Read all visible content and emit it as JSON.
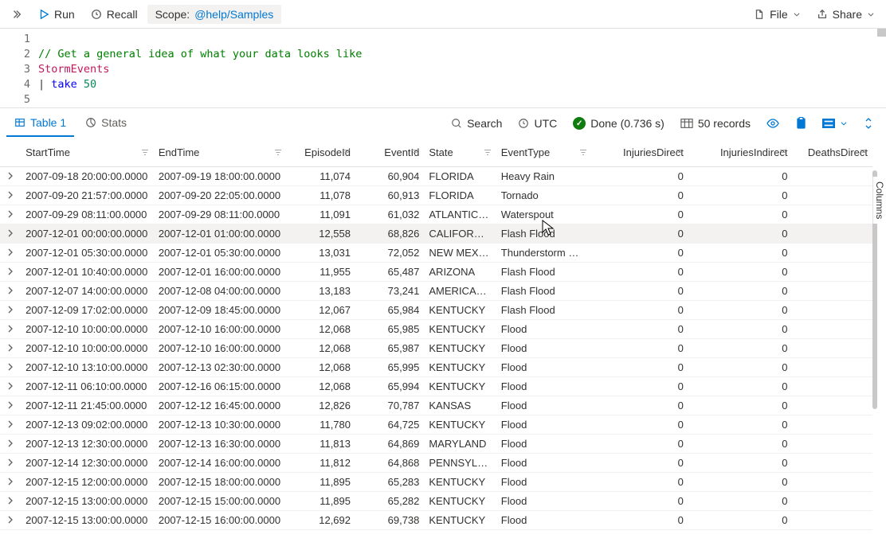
{
  "toolbar": {
    "run": "Run",
    "recall": "Recall",
    "scope_label": "Scope:",
    "scope_value": "@help/Samples",
    "file": "File",
    "share": "Share"
  },
  "editor": {
    "lines": [
      "1",
      "2",
      "3",
      "4",
      "5"
    ],
    "l1_comment": "// Get a general idea of what your data looks like",
    "l2_ident": "StormEvents",
    "l3_pipe": "| ",
    "l3_kw": "take ",
    "l3_num": "50"
  },
  "results": {
    "tab_table": "Table 1",
    "tab_stats": "Stats",
    "search": "Search",
    "utc": "UTC",
    "done": "Done (0.736 s)",
    "records": "50 records",
    "columns_tab": "Columns"
  },
  "columns": [
    "StartTime",
    "EndTime",
    "EpisodeId",
    "EventId",
    "State",
    "EventType",
    "InjuriesDirect",
    "InjuriesIndirect",
    "DeathsDirect"
  ],
  "col_align": [
    "left",
    "left",
    "right",
    "right",
    "left",
    "left",
    "right",
    "right",
    "right"
  ],
  "rows": [
    [
      "2007-09-18 20:00:00.0000",
      "2007-09-19 18:00:00.0000",
      "11,074",
      "60,904",
      "FLORIDA",
      "Heavy Rain",
      "0",
      "0",
      ""
    ],
    [
      "2007-09-20 21:57:00.0000",
      "2007-09-20 22:05:00.0000",
      "11,078",
      "60,913",
      "FLORIDA",
      "Tornado",
      "0",
      "0",
      ""
    ],
    [
      "2007-09-29 08:11:00.0000",
      "2007-09-29 08:11:00.0000",
      "11,091",
      "61,032",
      "ATLANTIC…",
      "Waterspout",
      "0",
      "0",
      ""
    ],
    [
      "2007-12-01 00:00:00.0000",
      "2007-12-01 01:00:00.0000",
      "12,558",
      "68,826",
      "CALIFORN…",
      "Flash Flood",
      "0",
      "0",
      ""
    ],
    [
      "2007-12-01 05:30:00.0000",
      "2007-12-01 05:30:00.0000",
      "13,031",
      "72,052",
      "NEW MEX…",
      "Thunderstorm Wind",
      "0",
      "0",
      ""
    ],
    [
      "2007-12-01 10:40:00.0000",
      "2007-12-01 16:00:00.0000",
      "11,955",
      "65,487",
      "ARIZONA",
      "Flash Flood",
      "0",
      "0",
      ""
    ],
    [
      "2007-12-07 14:00:00.0000",
      "2007-12-08 04:00:00.0000",
      "13,183",
      "73,241",
      "AMERICA…",
      "Flash Flood",
      "0",
      "0",
      ""
    ],
    [
      "2007-12-09 17:02:00.0000",
      "2007-12-09 18:45:00.0000",
      "12,067",
      "65,984",
      "KENTUCKY",
      "Flash Flood",
      "0",
      "0",
      ""
    ],
    [
      "2007-12-10 10:00:00.0000",
      "2007-12-10 16:00:00.0000",
      "12,068",
      "65,985",
      "KENTUCKY",
      "Flood",
      "0",
      "0",
      ""
    ],
    [
      "2007-12-10 10:00:00.0000",
      "2007-12-10 16:00:00.0000",
      "12,068",
      "65,987",
      "KENTUCKY",
      "Flood",
      "0",
      "0",
      ""
    ],
    [
      "2007-12-10 13:10:00.0000",
      "2007-12-13 02:30:00.0000",
      "12,068",
      "65,995",
      "KENTUCKY",
      "Flood",
      "0",
      "0",
      ""
    ],
    [
      "2007-12-11 06:10:00.0000",
      "2007-12-16 06:15:00.0000",
      "12,068",
      "65,994",
      "KENTUCKY",
      "Flood",
      "0",
      "0",
      ""
    ],
    [
      "2007-12-11 21:45:00.0000",
      "2007-12-12 16:45:00.0000",
      "12,826",
      "70,787",
      "KANSAS",
      "Flood",
      "0",
      "0",
      ""
    ],
    [
      "2007-12-13 09:02:00.0000",
      "2007-12-13 10:30:00.0000",
      "11,780",
      "64,725",
      "KENTUCKY",
      "Flood",
      "0",
      "0",
      ""
    ],
    [
      "2007-12-13 12:30:00.0000",
      "2007-12-13 16:30:00.0000",
      "11,813",
      "64,869",
      "MARYLAND",
      "Flood",
      "0",
      "0",
      ""
    ],
    [
      "2007-12-14 12:30:00.0000",
      "2007-12-14 16:00:00.0000",
      "11,812",
      "64,868",
      "PENNSYL…",
      "Flood",
      "0",
      "0",
      ""
    ],
    [
      "2007-12-15 12:00:00.0000",
      "2007-12-15 18:00:00.0000",
      "11,895",
      "65,283",
      "KENTUCKY",
      "Flood",
      "0",
      "0",
      ""
    ],
    [
      "2007-12-15 13:00:00.0000",
      "2007-12-15 15:00:00.0000",
      "11,895",
      "65,282",
      "KENTUCKY",
      "Flood",
      "0",
      "0",
      ""
    ],
    [
      "2007-12-15 13:00:00.0000",
      "2007-12-15 16:00:00.0000",
      "12,692",
      "69,738",
      "KENTUCKY",
      "Flood",
      "0",
      "0",
      ""
    ]
  ],
  "hover_row": 3
}
